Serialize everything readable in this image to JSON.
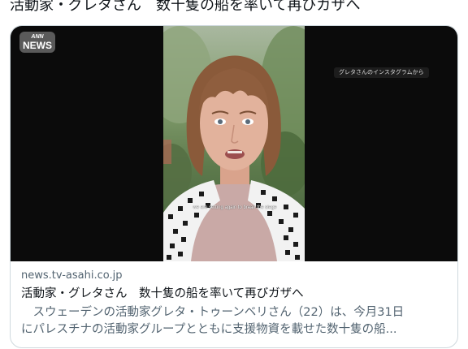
{
  "tweet": {
    "text": "活動家・グレタさん　数十隻の船を率いて再びガザへ"
  },
  "card": {
    "image": {
      "logo_top": "ANN",
      "logo_bottom": "NEWS",
      "credit_overlay": "グレタさんのインスタグラムから",
      "subtitle": "we are setting again to break the siege"
    },
    "domain": "news.tv-asahi.co.jp",
    "title": "活動家・グレタさん　数十隻の船を率いて再びガザへ",
    "description_line1": "　スウェーデンの活動家グレタ・トゥーンベリさん（22）は、今月31日",
    "description_line2": "にパレスチナの活動家グループとともに支援物資を載せた数十隻の船..."
  }
}
